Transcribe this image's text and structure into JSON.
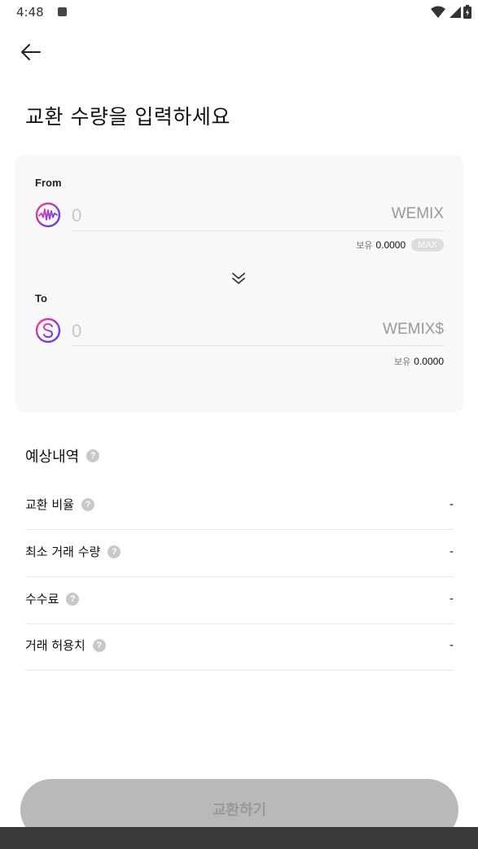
{
  "status_bar": {
    "time": "4:48",
    "icons": [
      "notification-a-icon",
      "wifi-icon",
      "signal-icon",
      "battery-icon"
    ]
  },
  "header": {
    "back_icon": "arrow-left-icon",
    "title": "교환 수량을 입력하세요"
  },
  "swap": {
    "from": {
      "label": "From",
      "icon": "wemix-token-icon",
      "amount_placeholder": "0",
      "token": "WEMIX",
      "balance_label": "보유",
      "balance_value": "0.0000",
      "max_label": "MAX"
    },
    "swap_icon": "double-chevron-down-icon",
    "to": {
      "label": "To",
      "icon": "wemix-dollar-token-icon",
      "amount_placeholder": "0",
      "token": "WEMIX$",
      "balance_label": "보유",
      "balance_value": "0.0000"
    }
  },
  "details": {
    "title": "예상내역",
    "rows": [
      {
        "label": "교환 비율",
        "value": "-"
      },
      {
        "label": "최소 거래 수량",
        "value": "-"
      },
      {
        "label": "수수료",
        "value": "-"
      },
      {
        "label": "거래 허용치",
        "value": "-"
      }
    ]
  },
  "footer": {
    "exchange_button": "교환하기"
  },
  "colors": {
    "card_background": "#f8f8f8",
    "button_disabled": "#b9b9b9",
    "token_gradient_start": "#ff3d8b",
    "token_gradient_end": "#4a3dff"
  }
}
